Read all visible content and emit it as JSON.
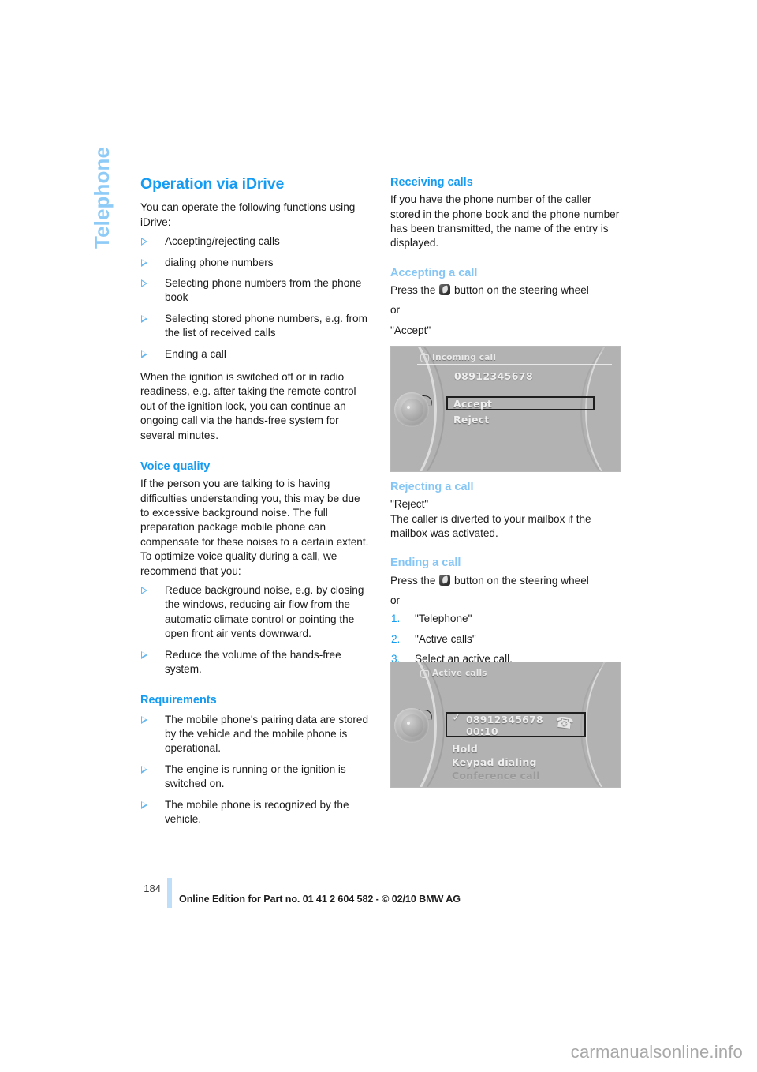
{
  "section_tab": {
    "label": "Telephone"
  },
  "left_column": {
    "heading": "Operation via iDrive",
    "intro": "You can operate the following functions using iDrive:",
    "function_bullets": [
      "Accepting/rejecting calls",
      "dialing phone numbers",
      "Selecting phone numbers from the phone book",
      "Selecting stored phone numbers, e.g. from the list of received calls",
      "Ending a call"
    ],
    "ignition_note": "When the ignition is switched off or in radio readiness, e.g. after taking the remote control out of the ignition lock, you can continue an ongoing call via the hands-free system for several minutes.",
    "voice_quality": {
      "heading": "Voice quality",
      "body": "If the person you are talking to is having difficulties understanding you, this may be due to excessive background noise. The full preparation package mobile phone can compensate for these noises to a certain extent. To optimize voice quality during a call, we recommend that you:",
      "bullets": [
        "Reduce background noise, e.g. by closing the windows, reducing air flow from the automatic climate control or pointing the open front air vents downward.",
        "Reduce the volume of the hands-free system."
      ]
    },
    "requirements": {
      "heading": "Requirements",
      "bullets": [
        "The mobile phone's pairing data are stored by the vehicle and the mobile phone is operational.",
        "The engine is running or the ignition is switched on.",
        "The mobile phone is recognized by the vehicle."
      ]
    }
  },
  "right_column": {
    "receiving_calls": {
      "heading": "Receiving calls",
      "body": "If you have the phone number of the caller stored in the phone book and the phone number has been transmitted, the name of the entry is displayed."
    },
    "accepting_a_call": {
      "heading": "Accepting a call",
      "press_prefix": "Press the",
      "press_suffix": "button on the steering wheel",
      "or": "or",
      "option": "\"Accept\""
    },
    "rejecting_a_call": {
      "heading": "Rejecting a call",
      "option": "\"Reject\"",
      "body": "The caller is diverted to your mailbox if the mailbox was activated."
    },
    "ending_a_call": {
      "heading": "Ending a call",
      "press_prefix": "Press the",
      "press_suffix": "button on the steering wheel",
      "or": "or",
      "steps": [
        "\"Telephone\"",
        "\"Active calls\"",
        "Select an active call."
      ]
    }
  },
  "idrive_incoming": {
    "title": "Incoming call",
    "phone_number": "08912345678",
    "items": [
      "Accept",
      "Reject"
    ],
    "selected": "Accept"
  },
  "idrive_active": {
    "title": "Active calls",
    "phone_number": "08912345678",
    "duration": "00:10",
    "items": [
      "Hold",
      "Keypad dialing",
      "Conference call"
    ],
    "disabled_item": "Conference call"
  },
  "footer": {
    "page_number": "184",
    "edition_text": "Online Edition for Part no. 01 41 2 604 582 - © 02/10 BMW AG"
  },
  "watermark": {
    "text": "carmanualsonline.info"
  },
  "colors": {
    "heading_blue": "#159cf2",
    "subheading_light_blue": "#85c6f6",
    "tab_blue": "#8ecbf7",
    "folio_bar": "#bfdff8"
  }
}
